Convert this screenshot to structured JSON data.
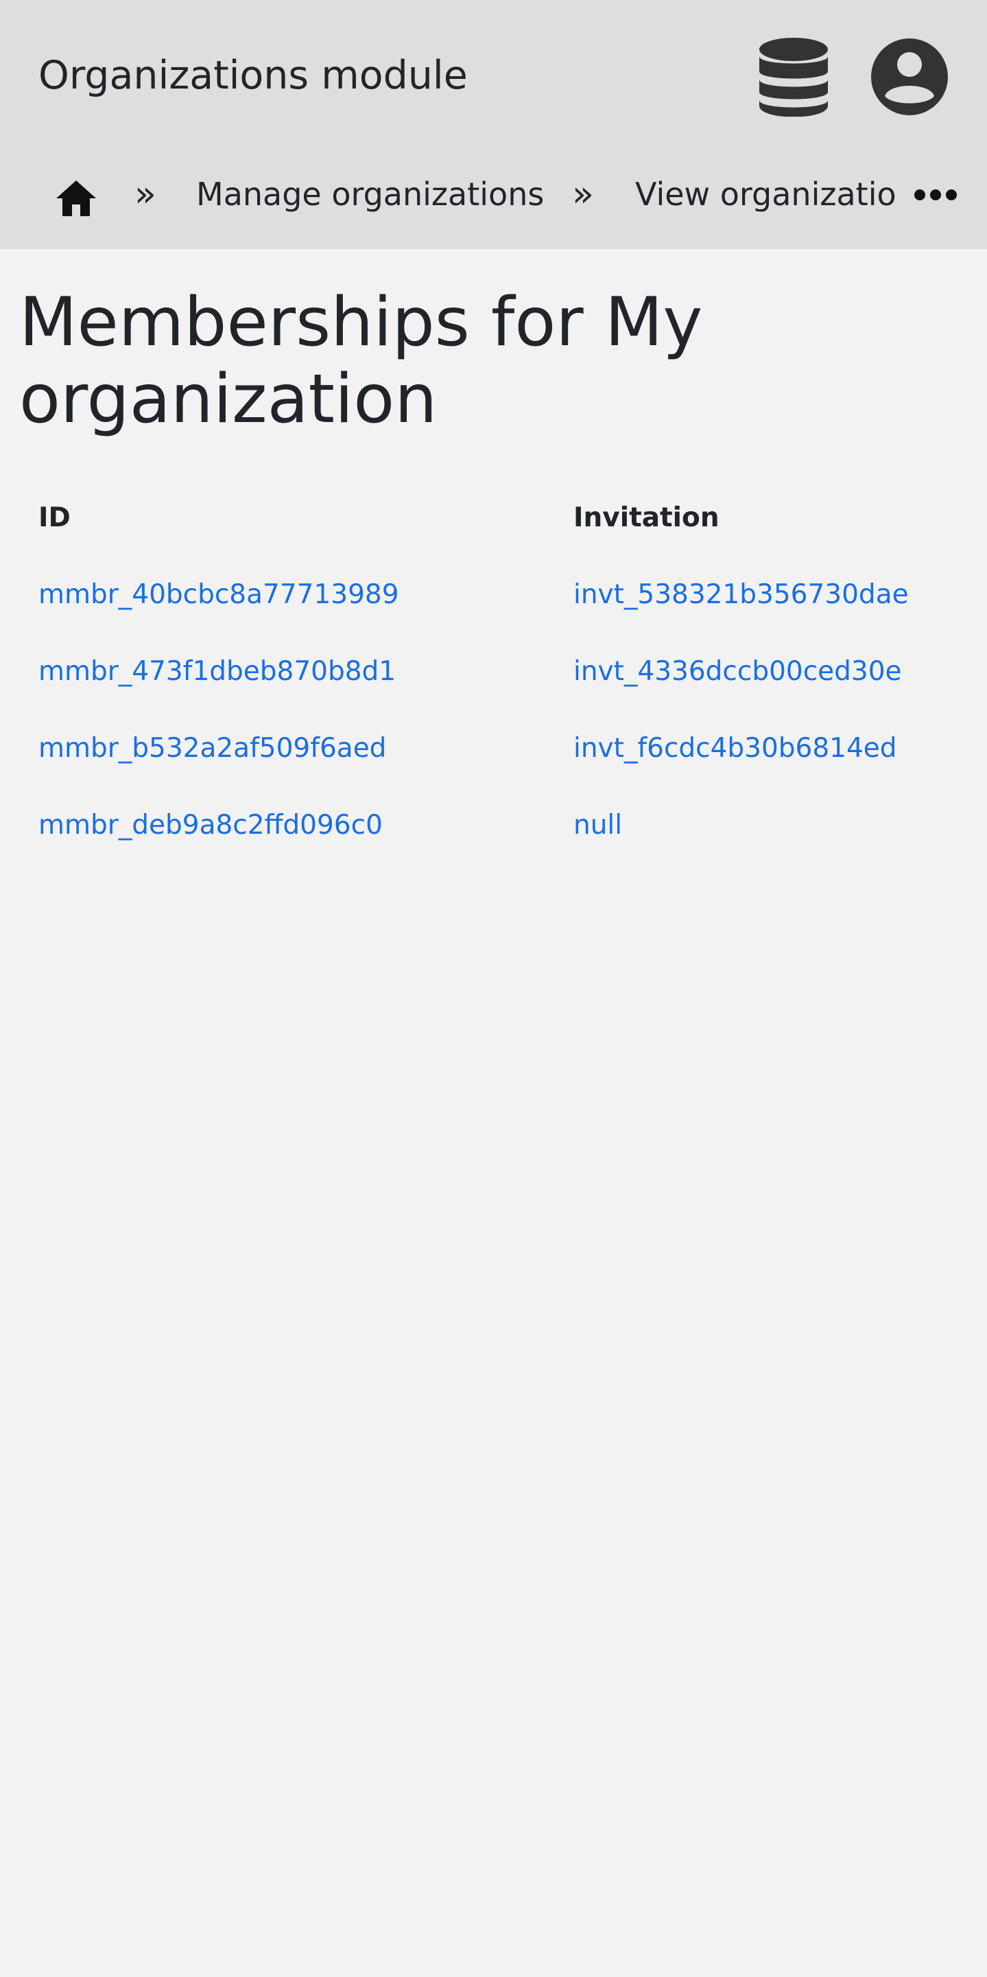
{
  "header": {
    "title": "Organizations module",
    "icons": {
      "database": "database-icon",
      "account": "account-circle-icon"
    },
    "icon_color": "#333333",
    "background": "#dedede"
  },
  "breadcrumb": {
    "home_icon": "home-icon",
    "separator": "»",
    "items": [
      {
        "label": "Manage organizations"
      },
      {
        "label": "View organization"
      }
    ],
    "more_icon": "more-horizontal-icon"
  },
  "main": {
    "title": "Memberships for My organization",
    "table": {
      "columns": [
        "ID",
        "Invitation"
      ],
      "rows": [
        {
          "id": "mmbr_40bcbc8a77713989",
          "invitation": "invt_538321b356730dae"
        },
        {
          "id": "mmbr_473f1dbeb870b8d1",
          "invitation": "invt_4336dccb00ced30e"
        },
        {
          "id": "mmbr_b532a2af509f6aed",
          "invitation": "invt_f6cdc4b30b6814ed"
        },
        {
          "id": "mmbr_deb9a8c2ffd096c0",
          "invitation": "null"
        }
      ]
    }
  },
  "colors": {
    "page_background": "#f2f2f2",
    "link": "#1a6ee3",
    "text": "#212529"
  }
}
